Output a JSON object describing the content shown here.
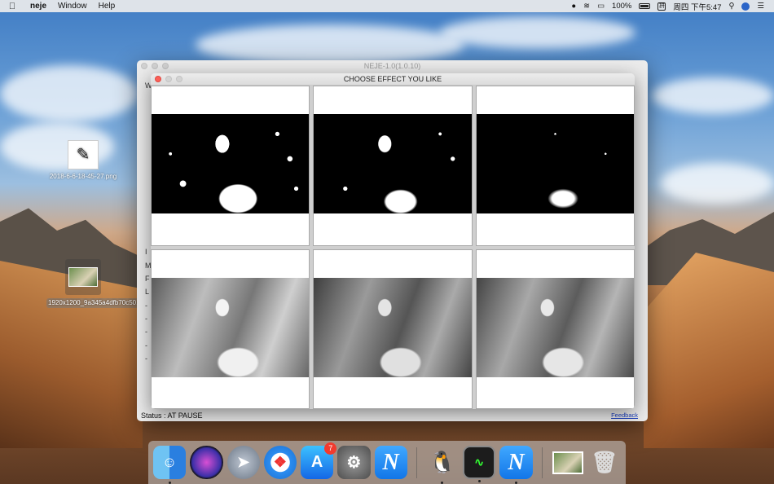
{
  "menubar": {
    "apple": "",
    "app_name": "neje",
    "menus": [
      "Window",
      "Help"
    ],
    "battery": "100%",
    "datetime": "周四 下午5:47",
    "input_method": "拼"
  },
  "desktop": {
    "icons": [
      {
        "label": "2018-6-6-18-45-27.png"
      },
      {
        "label": "1920x1200_9a345a4dfb70c50.jpg"
      }
    ]
  },
  "main_window": {
    "title": "NEJE-1.0(1.0.10)",
    "status": "Status : AT PAUSE",
    "feedback": "Feedback",
    "side_labels": [
      "W",
      "I",
      "M",
      "F",
      "L",
      "-",
      "-",
      "-",
      "-",
      "-"
    ]
  },
  "dialog": {
    "title": "CHOOSE EFFECT YOU LIKE",
    "effects": [
      {
        "style": "bw1"
      },
      {
        "style": "bw2"
      },
      {
        "style": "bw3"
      },
      {
        "style": "gray1"
      },
      {
        "style": "gray2"
      },
      {
        "style": "gray3"
      }
    ]
  },
  "dock": {
    "items": [
      {
        "name": "Finder",
        "running": true
      },
      {
        "name": "Siri",
        "running": false
      },
      {
        "name": "Launchpad",
        "running": false
      },
      {
        "name": "Safari",
        "running": false
      },
      {
        "name": "App Store",
        "running": false,
        "badge": "7"
      },
      {
        "name": "System Preferences",
        "running": false
      },
      {
        "name": "NEJE",
        "running": false
      },
      {
        "name": "QQ",
        "running": true
      },
      {
        "name": "Activity Monitor",
        "running": true
      },
      {
        "name": "NEJE",
        "running": true
      },
      {
        "name": "Photo",
        "running": false
      },
      {
        "name": "Trash",
        "running": false
      }
    ],
    "neje_letter": "N"
  },
  "colors": {
    "accent": "#1276e8",
    "close_red": "#fc5f57",
    "link": "#1a3fc0"
  }
}
